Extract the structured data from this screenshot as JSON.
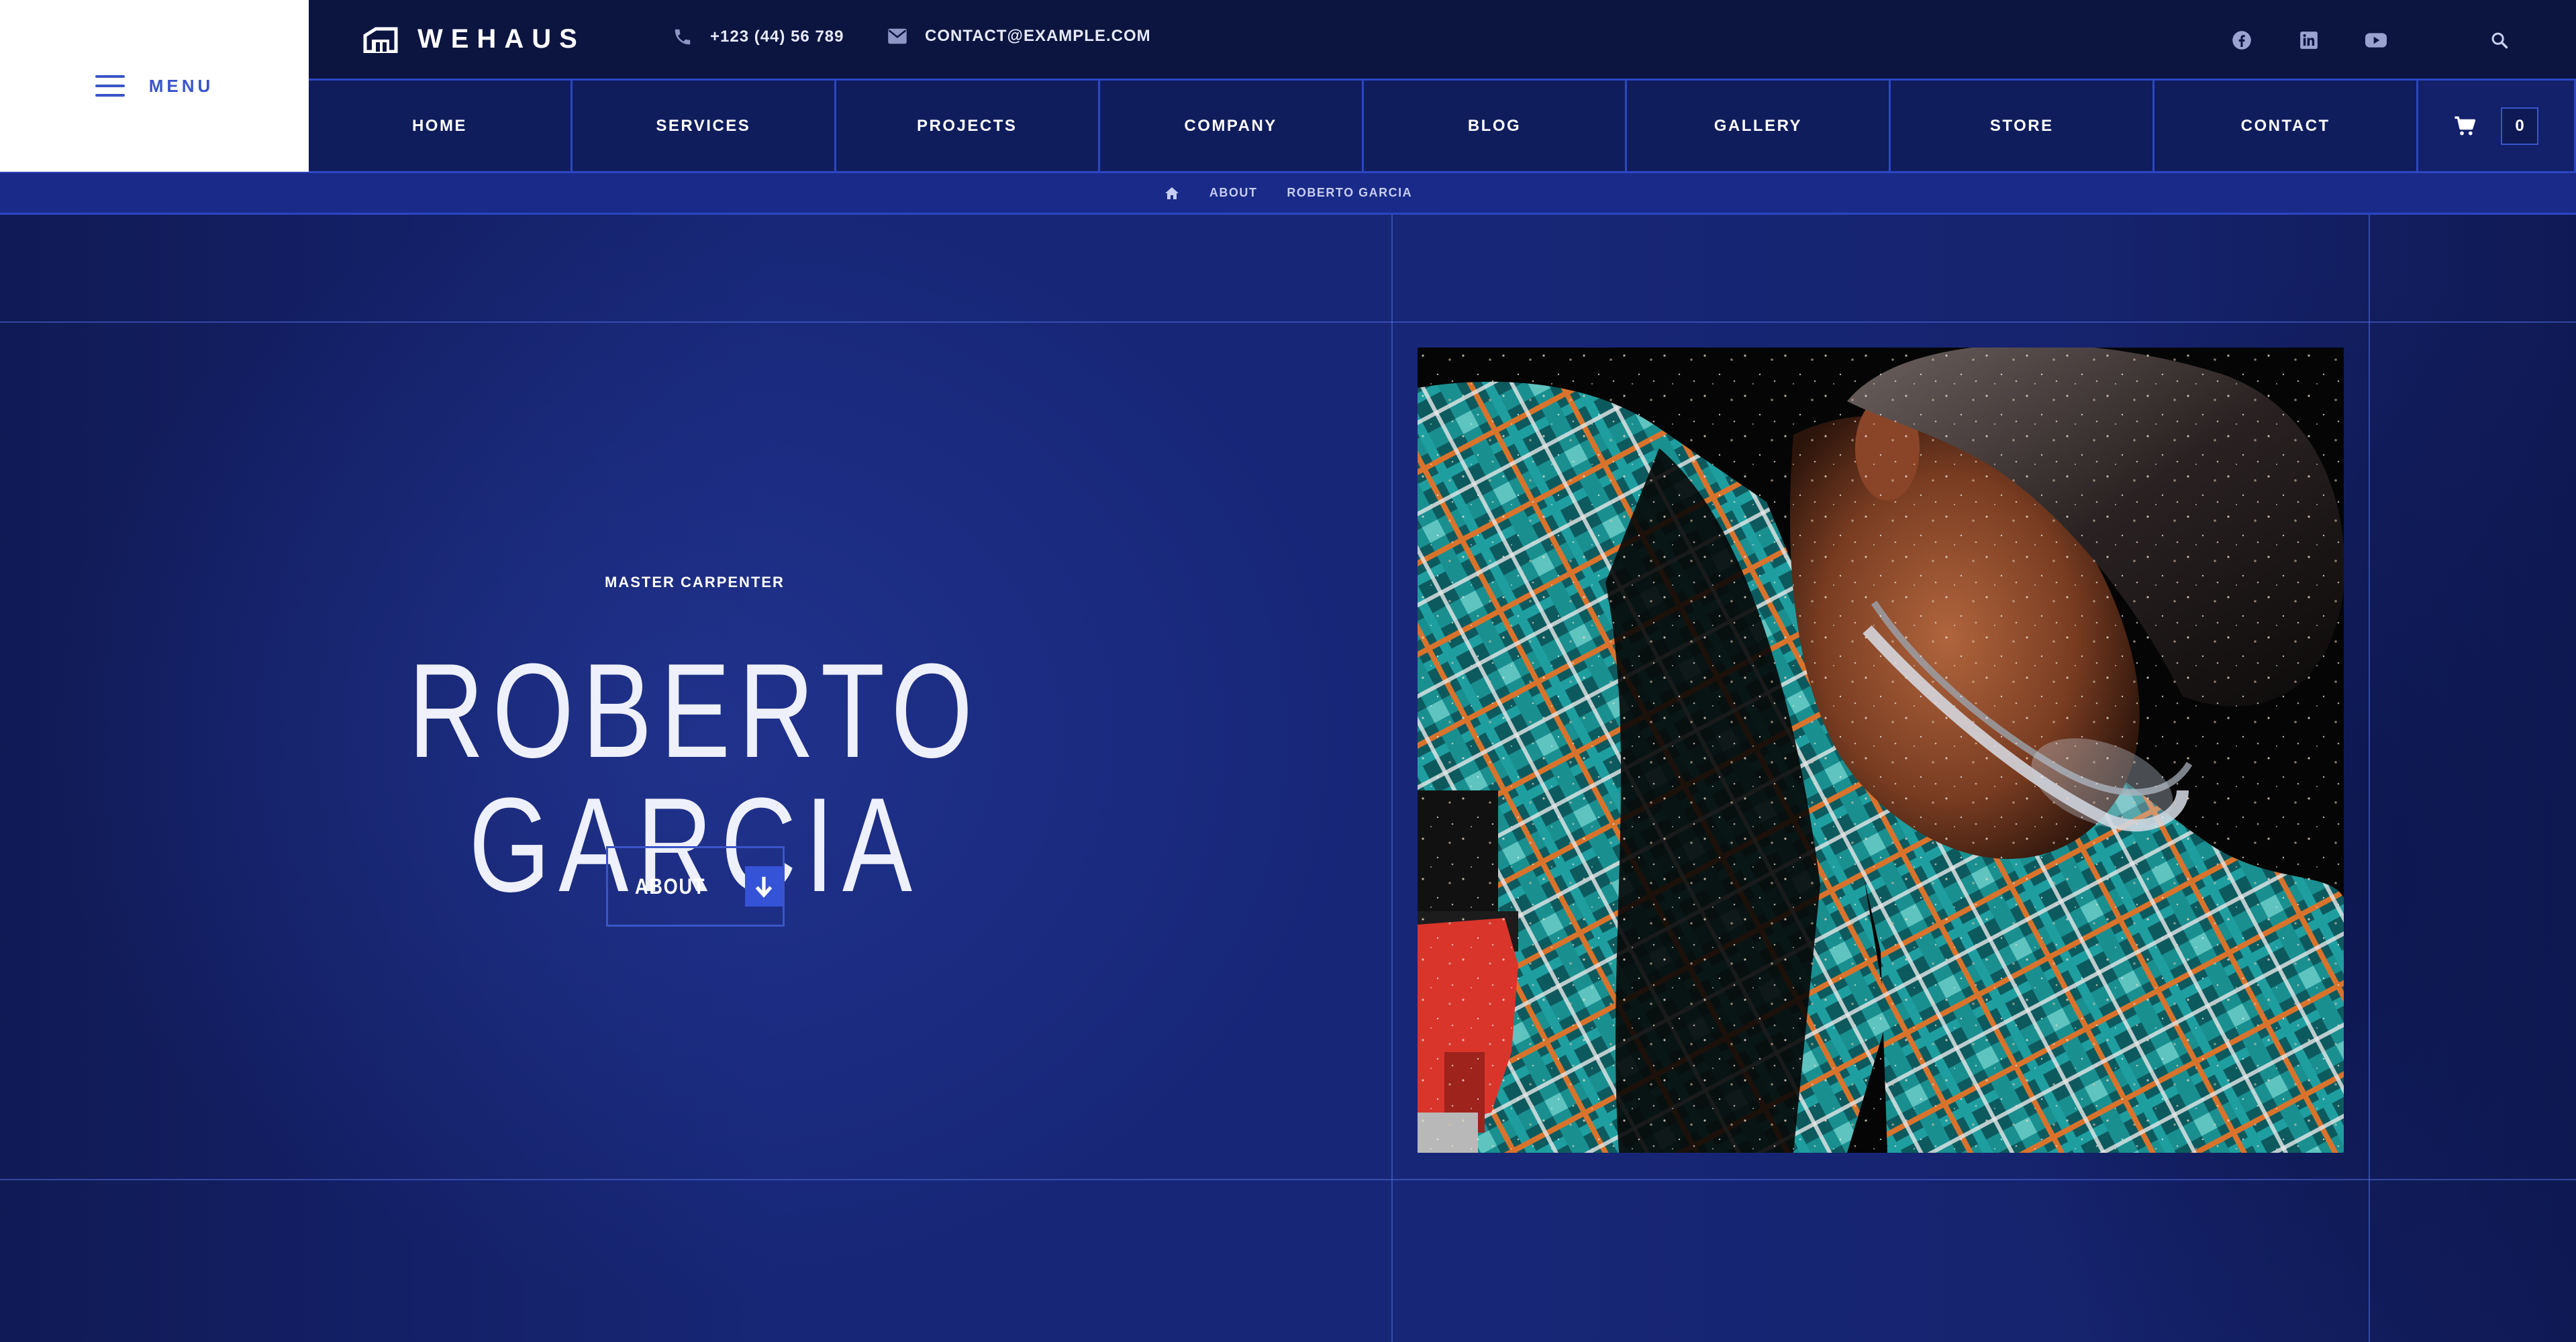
{
  "header": {
    "menu_label": "MENU",
    "logo_text": "WEHAUS",
    "phone": "+123 (44) 56 789",
    "email": "CONTACT@EXAMPLE.COM",
    "social_icons": [
      "facebook-icon",
      "linkedin-icon",
      "youtube-icon"
    ],
    "search_icon": "search-icon"
  },
  "nav": {
    "items": [
      {
        "label": "HOME"
      },
      {
        "label": "SERVICES"
      },
      {
        "label": "PROJECTS"
      },
      {
        "label": "COMPANY"
      },
      {
        "label": "BLOG"
      },
      {
        "label": "GALLERY"
      },
      {
        "label": "STORE"
      },
      {
        "label": "CONTACT"
      }
    ],
    "cart_count": "0"
  },
  "breadcrumb": {
    "home_icon": "home-icon",
    "items": [
      "ABOUT",
      "ROBERTO GARCIA"
    ]
  },
  "hero": {
    "eyebrow": "MASTER CARPENTER",
    "title": "ROBERTO GARCIA",
    "button_label": "ABOUT"
  },
  "colors": {
    "background": "#172676",
    "topbar": "#0c1540",
    "accent": "#3553d6",
    "line": "#2d46c4",
    "menu_box": "#ffffff"
  }
}
